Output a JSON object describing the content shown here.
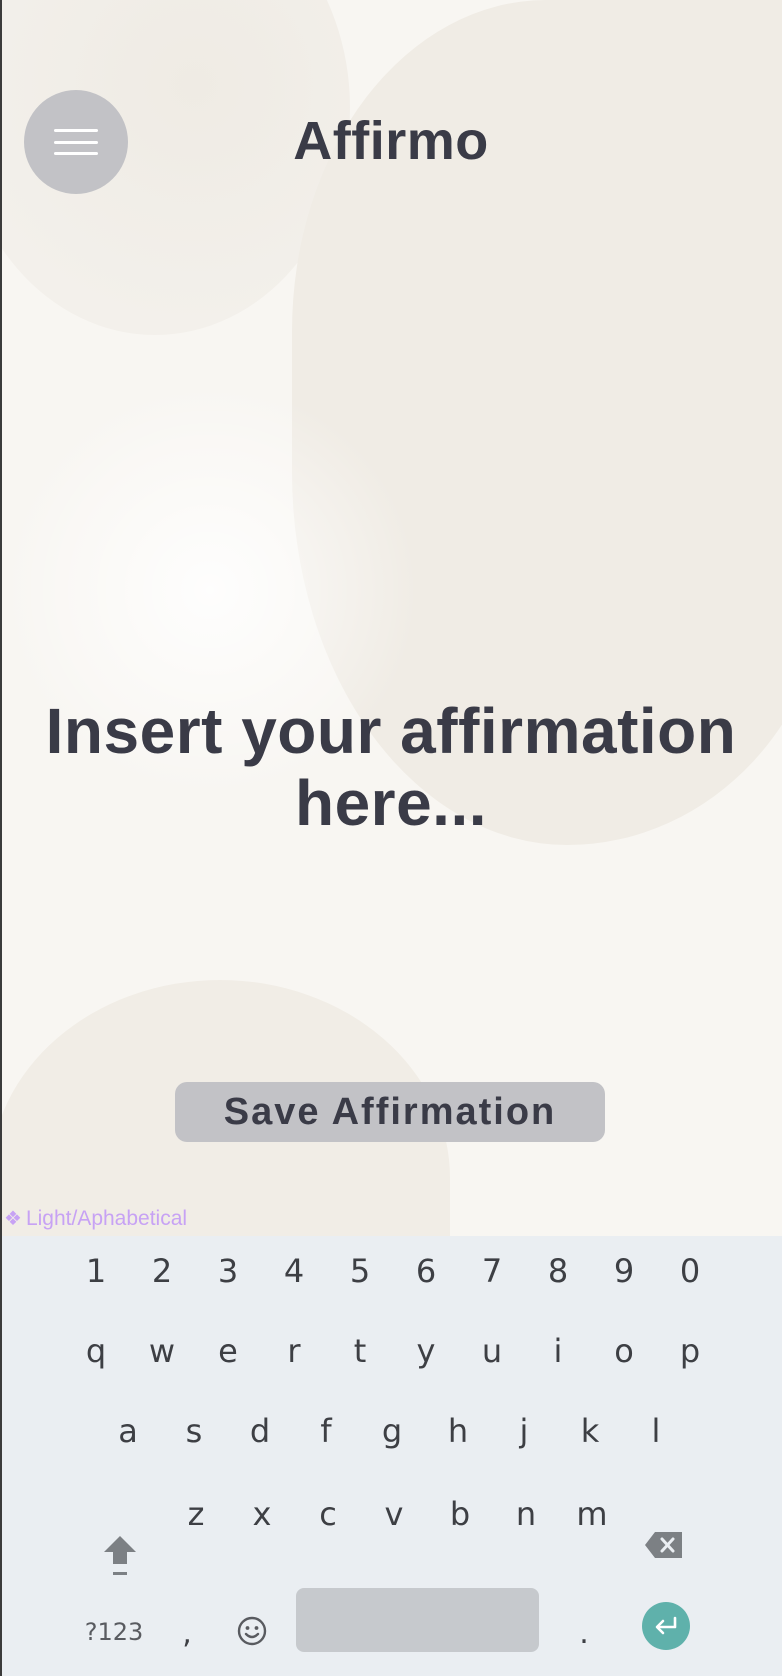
{
  "header": {
    "title": "Affirmo",
    "menu_icon": "hamburger-menu-icon"
  },
  "main": {
    "affirmation_text": "Insert your affirmation here...",
    "save_button_label": "Save Affirmation"
  },
  "overlay": {
    "layer_label": "Light/Aphabetical",
    "layer_icon": "component-diamond-icon"
  },
  "keyboard": {
    "row1": [
      "1",
      "2",
      "3",
      "4",
      "5",
      "6",
      "7",
      "8",
      "9",
      "0"
    ],
    "row2": [
      "q",
      "w",
      "e",
      "r",
      "t",
      "y",
      "u",
      "i",
      "o",
      "p"
    ],
    "row3": [
      "a",
      "s",
      "d",
      "f",
      "g",
      "h",
      "j",
      "k",
      "l"
    ],
    "row4": [
      "z",
      "x",
      "c",
      "v",
      "b",
      "n",
      "m"
    ],
    "symbols_label": "?123",
    "comma_label": ",",
    "period_label": ".",
    "shift_icon": "shift-arrow-icon",
    "backspace_icon": "backspace-icon",
    "emoji_icon": "emoji-smile-icon",
    "enter_icon": "enter-return-icon"
  },
  "colors": {
    "background": "#f8f6f2",
    "text_primary": "#3a3b47",
    "button_gray": "#c2c2c6",
    "keyboard_bg": "#eaeef2",
    "enter_teal": "#5fb1ab",
    "layer_label_purple": "#c7a2f4"
  }
}
